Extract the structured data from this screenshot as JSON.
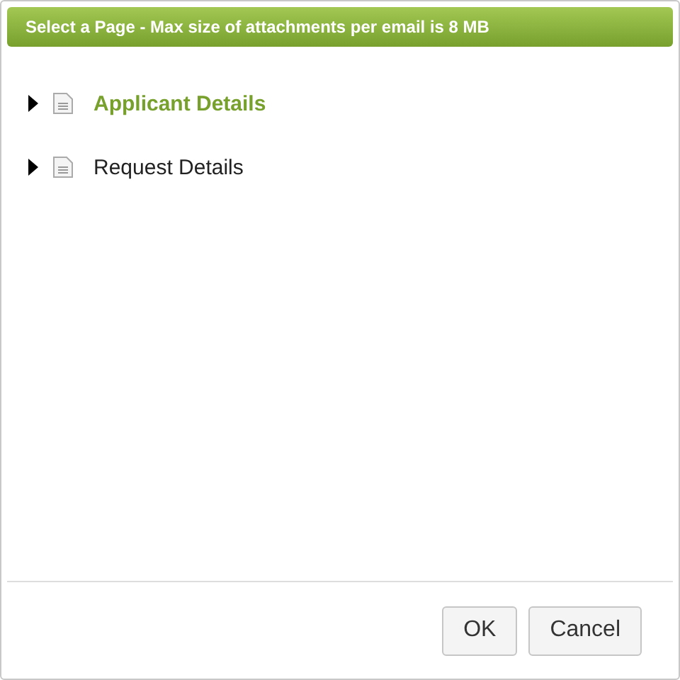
{
  "dialog": {
    "title": "Select a Page - Max size of attachments per email is 8 MB"
  },
  "tree": [
    {
      "label": "Applicant Details",
      "selected": true,
      "expanded": false
    },
    {
      "label": "Request Details",
      "selected": false,
      "expanded": false
    }
  ],
  "buttons": [
    {
      "label": "OK"
    },
    {
      "label": "Cancel"
    }
  ]
}
